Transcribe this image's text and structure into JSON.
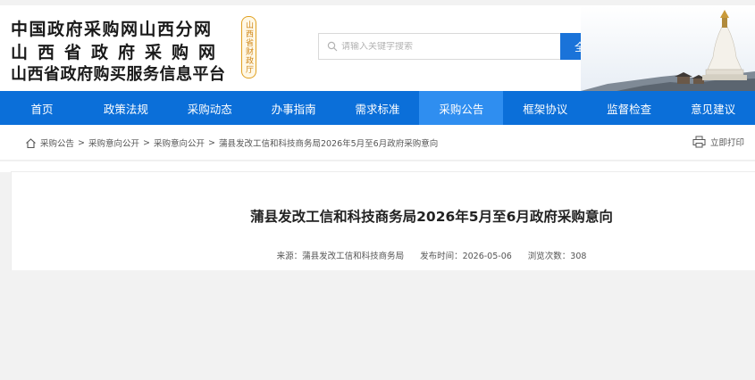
{
  "header": {
    "logo_line1": "中国政府采购网山西分网",
    "logo_line2": "山西省政府采购网",
    "logo_line3": "山西省政府购买服务信息平台",
    "seal_text": "山西省财政厅"
  },
  "search": {
    "placeholder": "请输入关键字搜索",
    "value": "",
    "button_label": "全站搜索"
  },
  "nav": {
    "items": [
      "首页",
      "政策法规",
      "采购动态",
      "办事指南",
      "需求标准",
      "采购公告",
      "框架协议",
      "监督检查",
      "意见建议"
    ],
    "active": "采购公告"
  },
  "breadcrumb": {
    "items": [
      "采购公告",
      "采购意向公开",
      "采购意向公开",
      "蒲县发改工信和科技商务局2026年5月至6月政府采购意向"
    ],
    "separator": ">"
  },
  "print_label": "立即打印",
  "article": {
    "title": "蒲县发改工信和科技商务局2026年5月至6月政府采购意向",
    "source": "来源：蒲县发改工信和科技商务局",
    "publish_time": "发布时间：2026-05-06",
    "views": "浏览次数：308"
  },
  "colors": {
    "nav_bg": "#0b6fd9",
    "nav_active": "#2f8ef0",
    "search_button": "#1a73d9"
  }
}
